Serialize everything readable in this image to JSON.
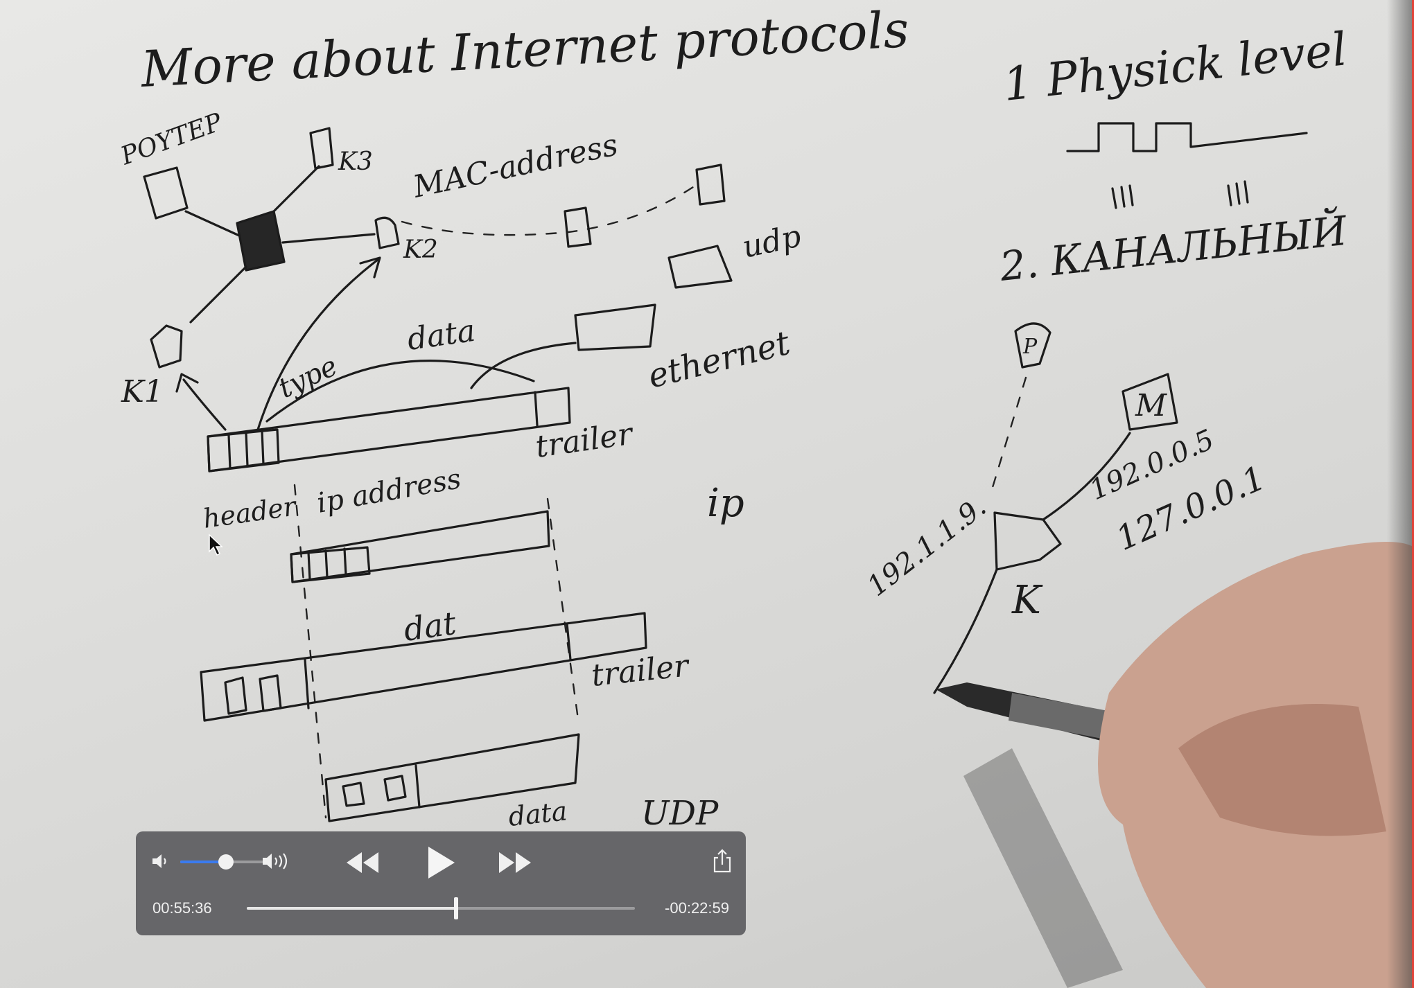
{
  "whiteboard": {
    "title": "More about Internet protocols",
    "labels": {
      "router": "POYTEP",
      "k3": "K3",
      "mac": "MAC-address",
      "k2": "K2",
      "k1": "K1",
      "type": "type",
      "data_top": "data",
      "ethernet": "ethernet",
      "trailer_top": "trailer",
      "header": "header",
      "ip_address": "ip address",
      "ip": "ip",
      "dat": "dat",
      "trailer_mid": "trailer",
      "data_bottom": "data",
      "udp_upper": "udp",
      "udp_lower": "UDP",
      "physical": "1  Physick level",
      "channel": "2. КАНАЛЬНЫЙ",
      "ip_1": "192.1.1.9.",
      "ip_2": "192.0.0.5",
      "ip_3": "127.0.0.1",
      "node_k": "K",
      "node_m": "M",
      "node_p": "P"
    }
  },
  "player": {
    "elapsed": "00:55:36",
    "remaining": "-00:22:59",
    "progress": 0.54,
    "volume": 0.55,
    "icons": {
      "volume_low": "speaker-low-icon",
      "volume_high": "speaker-high-icon",
      "rewind": "rewind-icon",
      "play": "play-icon",
      "fast_forward": "fast-forward-icon",
      "share": "share-icon"
    }
  }
}
